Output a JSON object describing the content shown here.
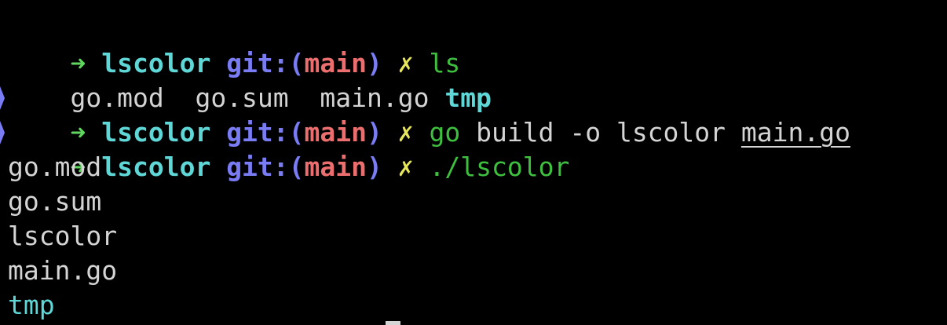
{
  "colors": {
    "background": "#000000",
    "text": "#d4d4d4",
    "arrow": "#5fd75f",
    "dir": "#5fd7d7",
    "git": "#7a7cf4",
    "branch": "#ec6e6e",
    "dirty": "#e6e65a",
    "command": "#3fbf3f",
    "folder_entry": "#5fd7d7"
  },
  "prompt": {
    "arrow": "➜",
    "dir": "lscolor",
    "git_prefix": "git:(",
    "branch": "main",
    "git_suffix": ")",
    "dirty_marker": "✗"
  },
  "session": {
    "cmd1": "ls",
    "ls_output": {
      "file1": "go.mod",
      "file2": "go.sum",
      "file3": "main.go",
      "dir1": "tmp"
    },
    "cmd2_name": "go",
    "cmd2_args": "build -o lscolor",
    "cmd2_file": "main.go",
    "cmd3": "./lscolor",
    "output_lines": [
      "go.mod",
      "go.sum",
      "lscolor",
      "main.go",
      "tmp"
    ]
  }
}
